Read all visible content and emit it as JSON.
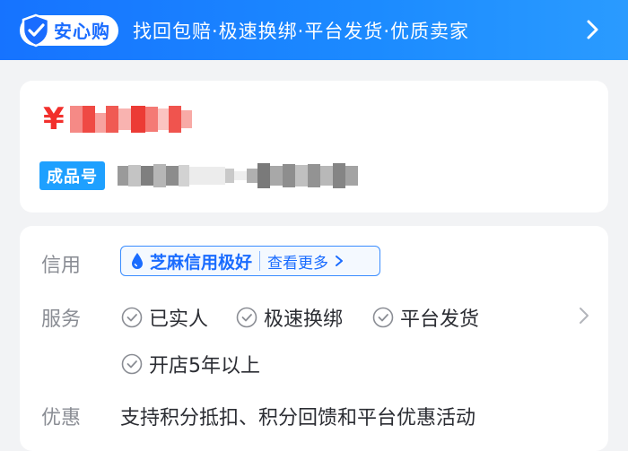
{
  "banner": {
    "badge_text": "安心购",
    "slogan": "找回包赔·极速换绑·平台发货·优质卖家"
  },
  "price": {
    "currency": "¥"
  },
  "product": {
    "tag": "成品号"
  },
  "credit": {
    "label": "信用",
    "badge_text": "芝麻信用极好",
    "more_link": "查看更多"
  },
  "service": {
    "label": "服务",
    "items": [
      "已实人",
      "极速换绑",
      "平台发货",
      "开店5年以上"
    ]
  },
  "promotion": {
    "label": "优惠",
    "text": "支持积分抵扣、积分回馈和平台优惠活动"
  },
  "colors": {
    "brand_blue": "#1a6cff",
    "price_red": "#f2302c",
    "tag_blue": "#1ea0ff"
  }
}
